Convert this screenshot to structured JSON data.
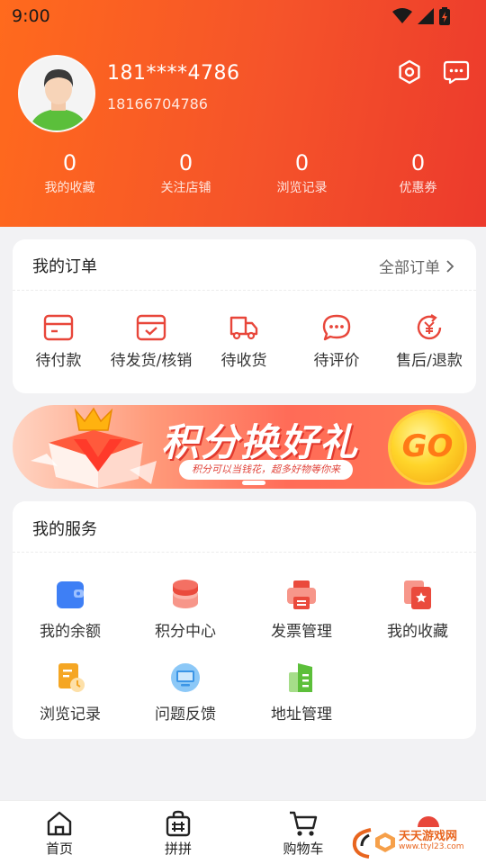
{
  "status_bar": {
    "time": "9:00"
  },
  "profile": {
    "phone_masked": "181****4786",
    "phone_full": "18166704786"
  },
  "stats": [
    {
      "value": "0",
      "label": "我的收藏"
    },
    {
      "value": "0",
      "label": "关注店铺"
    },
    {
      "value": "0",
      "label": "浏览记录"
    },
    {
      "value": "0",
      "label": "优惠券"
    }
  ],
  "orders": {
    "title": "我的订单",
    "all_label": "全部订单",
    "items": [
      {
        "label": "待付款",
        "icon": "wallet-icon"
      },
      {
        "label": "待发货/核销",
        "icon": "calendar-check-icon"
      },
      {
        "label": "待收货",
        "icon": "truck-icon"
      },
      {
        "label": "待评价",
        "icon": "comment-icon"
      },
      {
        "label": "售后/退款",
        "icon": "refund-icon"
      }
    ]
  },
  "banner": {
    "title": "积分换好礼",
    "subtitle": "积分可以当钱花，超多好物等你来",
    "go": "GO"
  },
  "services": {
    "title": "我的服务",
    "items": [
      {
        "label": "我的余额",
        "icon": "balance-icon"
      },
      {
        "label": "积分中心",
        "icon": "points-icon"
      },
      {
        "label": "发票管理",
        "icon": "invoice-icon"
      },
      {
        "label": "我的收藏",
        "icon": "favorite-icon"
      },
      {
        "label": "浏览记录",
        "icon": "history-icon"
      },
      {
        "label": "问题反馈",
        "icon": "feedback-icon"
      },
      {
        "label": "地址管理",
        "icon": "address-icon"
      }
    ]
  },
  "tabbar": {
    "items": [
      {
        "label": "首页",
        "icon": "home-icon"
      },
      {
        "label": "拼拼",
        "icon": "group-buy-icon"
      },
      {
        "label": "购物车",
        "icon": "cart-icon"
      }
    ]
  },
  "watermark": {
    "name": "天天游戏网",
    "url": "www.ttyl23.com"
  },
  "colors": {
    "primary": "#f5532a",
    "accent": "#e8463a"
  }
}
